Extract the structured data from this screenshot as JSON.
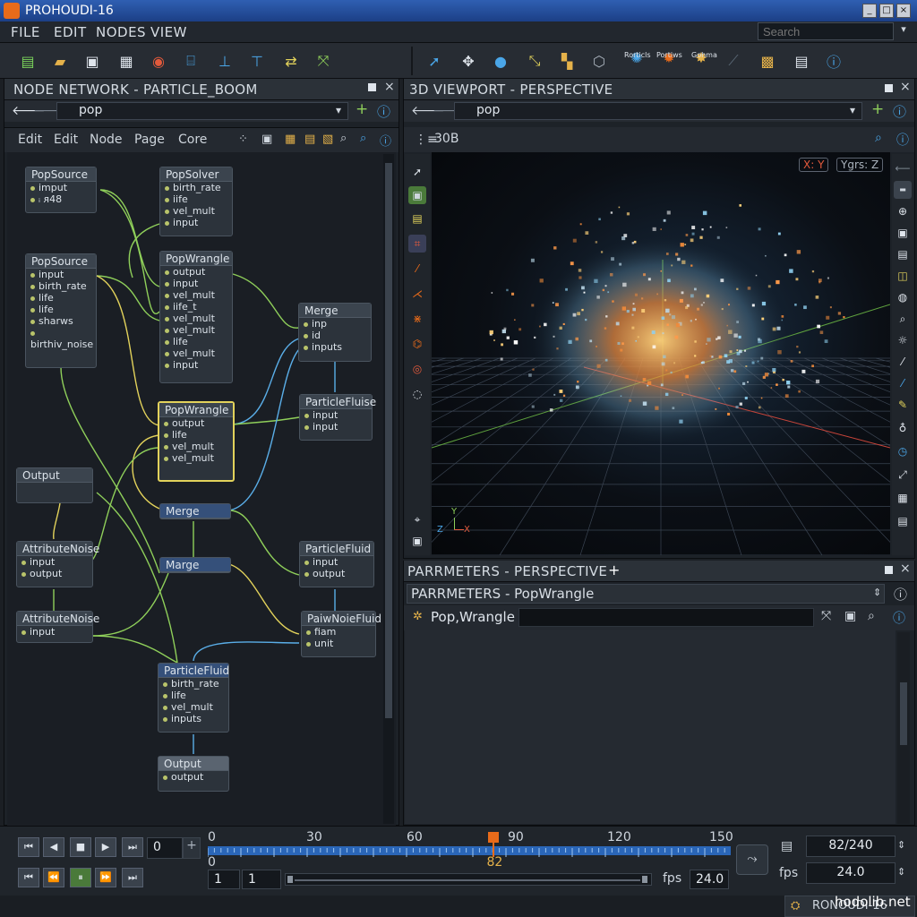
{
  "window": {
    "title": "PROHOUDI-16"
  },
  "menu": [
    "FILE",
    "EDIT",
    "NODES",
    "VIEW"
  ],
  "search": {
    "placeholder": "Search"
  },
  "toolbar": {
    "labels": [
      "Rorticls",
      "Portiws",
      "Gohma"
    ]
  },
  "network_pane": {
    "title": "NODE NETWORK - PARTICLE_BOOM",
    "path": "pop",
    "menu": [
      "Edit",
      "Edit",
      "Node",
      "Page",
      "Core"
    ]
  },
  "nodes": [
    {
      "id": "n1",
      "title": "PopSource",
      "rows": [
        "imput",
        "ᵢ ᴙ48"
      ]
    },
    {
      "id": "n2",
      "title": "PopSolver",
      "rows": [
        "birth_rate",
        "iife",
        "vel_mult",
        "input"
      ]
    },
    {
      "id": "n3",
      "title": "PopSource",
      "rows": [
        "input",
        "birth_rate",
        "life",
        "life",
        "sharws",
        "birthiv_noise"
      ]
    },
    {
      "id": "n4",
      "title": "PopWrangle",
      "rows": [
        "output",
        "input",
        "vel_mult",
        "iife_t",
        "vel_mult",
        "vel_mult",
        "life",
        "vel_mult",
        "input"
      ]
    },
    {
      "id": "n5",
      "title": "Merge",
      "rows": [
        "inp",
        "id",
        "inputs"
      ]
    },
    {
      "id": "n6",
      "title": "PopWrangle",
      "rows": [
        "output",
        "life",
        "vel_mult",
        "vel_mult"
      ]
    },
    {
      "id": "n7",
      "title": "ParticleFluise",
      "rows": [
        "input",
        "input"
      ]
    },
    {
      "id": "n8",
      "title": "Output",
      "rows": []
    },
    {
      "id": "n9",
      "title": "Merge",
      "rows": []
    },
    {
      "id": "n10",
      "title": "AttributeNoise",
      "rows": [
        "input",
        "output"
      ]
    },
    {
      "id": "n11",
      "title": "Marge",
      "rows": []
    },
    {
      "id": "n12",
      "title": "ParticleFluid",
      "rows": [
        "input",
        "output"
      ]
    },
    {
      "id": "n13",
      "title": "AttributeNoise",
      "rows": [
        "input"
      ]
    },
    {
      "id": "n14",
      "title": "PaiwNoieFluid",
      "rows": [
        "fiam",
        "unit"
      ]
    },
    {
      "id": "n15",
      "title": "ParticleFluid",
      "rows": [
        "birth_rate",
        "life",
        "vel_mult",
        "inputs"
      ]
    },
    {
      "id": "n16",
      "title": "Output",
      "rows": [
        "output"
      ]
    }
  ],
  "viewport_pane": {
    "title": "3D VIEWPORT - PERSPECTIVE",
    "path": "pop",
    "subtitle": "30B",
    "axis_left": "X: Y",
    "axis_right": "Ygrs: Z",
    "gizmo": {
      "x": "X",
      "y": "Y",
      "z": "Z"
    }
  },
  "params_pane": {
    "title": "PARRMETERS - PERSPECTIVE",
    "plus": "+",
    "header": "PARRMETERS - PopWrangle",
    "node_label": "Pop,Wrangle"
  },
  "timeline": {
    "frame_field": "0",
    "ticks": [
      "0",
      "30",
      "60",
      "90",
      "120",
      "150"
    ],
    "start_label": "0",
    "current": "82",
    "current_frac": 0.547,
    "range_start": "1",
    "range_end": "1",
    "fps_label": "fps",
    "fps": "24.0",
    "frame_count": "82/240",
    "fps_right_label": "fps",
    "fps_right": "24.0"
  },
  "status": {
    "text": "RONOUDI-16",
    "watermark": "hodolib.net"
  },
  "colors": {
    "accent": "#e86b1a",
    "wire_green": "#8fcf5a",
    "wire_yellow": "#e2d25b",
    "wire_blue": "#5aaee8"
  }
}
